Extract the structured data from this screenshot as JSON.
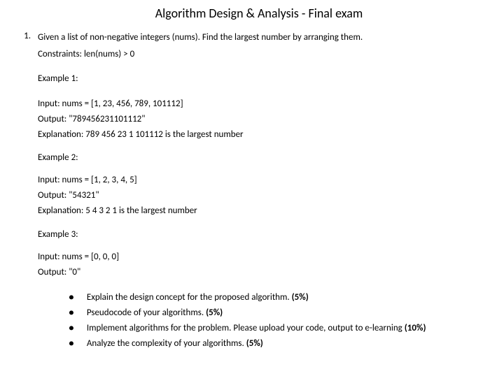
{
  "title": "Algorithm Design & Analysis - Final exam",
  "question": {
    "number": "1.",
    "text": "Given a list of non-negative integers (nums). Find the largest number by arranging them.",
    "constraints": "Constraints: len(nums) > 0"
  },
  "examples": [
    {
      "title": "Example 1:",
      "input": "Input: nums = [1, 23, 456, 789, 101112]",
      "output": "Output: \"789456231101112\"",
      "explanation": "Explanation: 789 456 23 1 101112 is the largest number"
    },
    {
      "title": "Example 2:",
      "input": "Input: nums = [1, 2, 3, 4, 5]",
      "output": "Output: \"54321\"",
      "explanation": "Explanation: 5 4 3 2 1 is the largest number"
    },
    {
      "title": "Example 3:",
      "input": "Input: nums = [0, 0, 0]",
      "output": "Output: \"0\"",
      "explanation": ""
    }
  ],
  "tasks": [
    {
      "text": "Explain the design concept for the proposed algorithm. ",
      "weight": "(5%)"
    },
    {
      "text": "Pseudocode of your algorithms. ",
      "weight": "(5%)"
    },
    {
      "text": "Implement algorithms for the problem. Please upload your code, output to e-learning ",
      "weight": "(10%)"
    },
    {
      "text": "Analyze the complexity of your algorithms. ",
      "weight": "(5%)"
    }
  ]
}
